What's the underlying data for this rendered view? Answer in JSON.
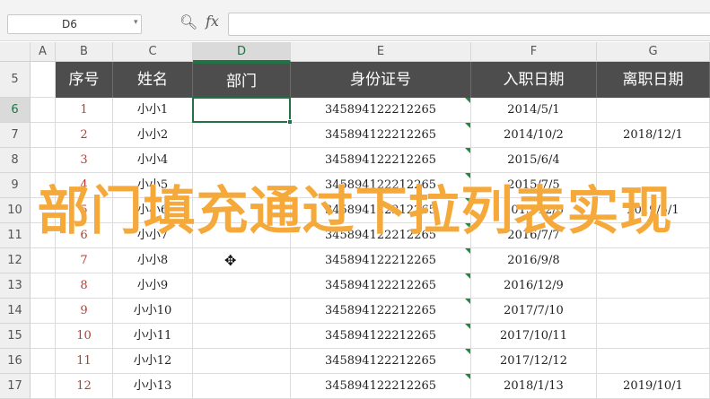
{
  "formula_bar": {
    "name_box": "D6",
    "fx_label": "fx",
    "formula_value": ""
  },
  "columns": [
    "A",
    "B",
    "C",
    "D",
    "E",
    "F",
    "G"
  ],
  "row_numbers": [
    "5",
    "6",
    "7",
    "8",
    "9",
    "10",
    "11",
    "12",
    "13",
    "14",
    "15",
    "16",
    "17"
  ],
  "table": {
    "headers": [
      "序号",
      "姓名",
      "部门",
      "身份证号",
      "入职日期",
      "离职日期"
    ],
    "rows": [
      {
        "seq": "1",
        "name": "小小1",
        "dept": "",
        "id": "345894122212265",
        "join": "2014/5/1",
        "leave": ""
      },
      {
        "seq": "2",
        "name": "小小2",
        "dept": "",
        "id": "345894122212265",
        "join": "2014/10/2",
        "leave": "2018/12/1"
      },
      {
        "seq": "3",
        "name": "小小4",
        "dept": "",
        "id": "345894122212265",
        "join": "2015/6/4",
        "leave": ""
      },
      {
        "seq": "4",
        "name": "小小5",
        "dept": "",
        "id": "345894122212265",
        "join": "2015/7/5",
        "leave": ""
      },
      {
        "seq": "5",
        "name": "小小6",
        "dept": "",
        "id": "345894122212265",
        "join": "2015/12/6",
        "leave": "2019/5/1"
      },
      {
        "seq": "6",
        "name": "小小7",
        "dept": "",
        "id": "345894122212265",
        "join": "2016/7/7",
        "leave": ""
      },
      {
        "seq": "7",
        "name": "小小8",
        "dept": "",
        "id": "345894122212265",
        "join": "2016/9/8",
        "leave": ""
      },
      {
        "seq": "8",
        "name": "小小9",
        "dept": "",
        "id": "345894122212265",
        "join": "2016/12/9",
        "leave": ""
      },
      {
        "seq": "9",
        "name": "小小10",
        "dept": "",
        "id": "345894122212265",
        "join": "2017/7/10",
        "leave": ""
      },
      {
        "seq": "10",
        "name": "小小11",
        "dept": "",
        "id": "345894122212265",
        "join": "2017/10/11",
        "leave": ""
      },
      {
        "seq": "11",
        "name": "小小12",
        "dept": "",
        "id": "345894122212265",
        "join": "2017/12/12",
        "leave": ""
      },
      {
        "seq": "12",
        "name": "小小13",
        "dept": "",
        "id": "345894122212265",
        "join": "2018/1/13",
        "leave": "2019/10/1"
      }
    ]
  },
  "overlay_caption": "部门填充通过下拉列表实现",
  "colors": {
    "header_bg": "#4d4d4d",
    "selection": "#217346",
    "seq_text": "#c0392b",
    "caption": "#f5a93a"
  },
  "icons": {
    "zoom": "zoom-icon",
    "cursor": "cell-cursor-icon"
  }
}
